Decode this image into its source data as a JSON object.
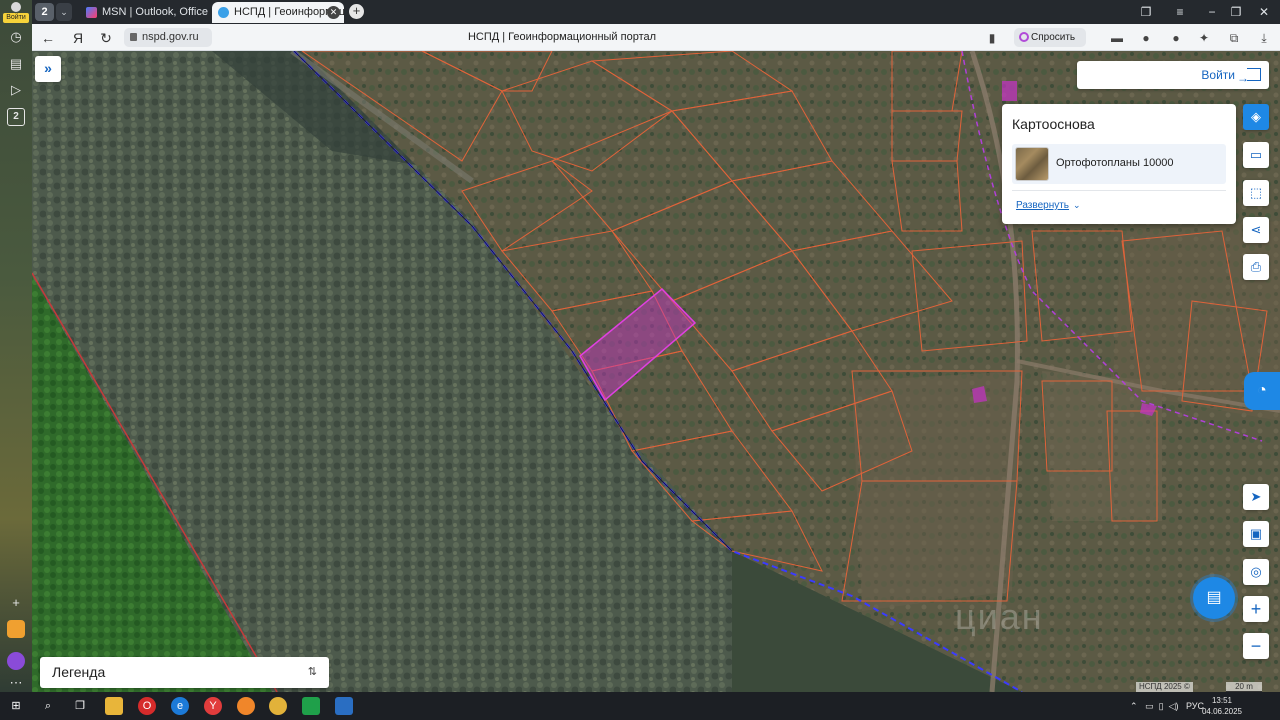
{
  "sidebar": {
    "login_label": "Войти",
    "tab_count_badge": "2"
  },
  "tabstrip": {
    "tab_count": "2",
    "tabs": [
      {
        "label": "MSN | Outlook, Office, Sky",
        "icon": "msn-icon",
        "active": false
      },
      {
        "label": "НСПД | Геоинформац",
        "icon": "nspd-icon",
        "active": true
      }
    ]
  },
  "addressbar": {
    "url": "nspd.gov.ru",
    "page_title": "НСПД | Геоинформационный портал",
    "ask_label": "Спросить"
  },
  "map": {
    "login_button": "Войти",
    "basemap": {
      "title": "Картооснова",
      "selected": "Ортофотопланы 10000",
      "expand_link": "Развернуть"
    },
    "legend_label": "Легенда",
    "watermark": "циан",
    "attribution": "НСПД 2025 ©",
    "scale_label": "20 m"
  },
  "taskbar": {
    "language": "РУС",
    "time": "13:51",
    "date": "04.06.2025"
  },
  "colors": {
    "accent": "#1e88e5",
    "parcel_outline": "#e0633a",
    "selected_parcel": "#c832c8",
    "boundary_line": "#3b3bff"
  }
}
